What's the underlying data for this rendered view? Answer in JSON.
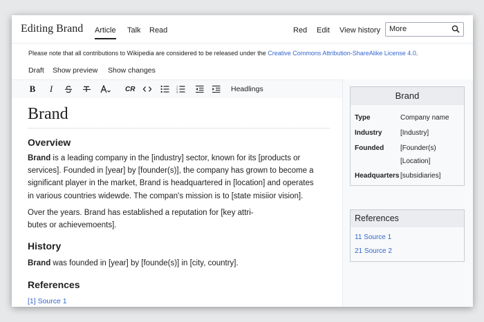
{
  "header": {
    "page_heading": "Editing Brand",
    "tabs": [
      "Article",
      "Talk",
      "Read"
    ],
    "right_tabs": [
      "Red",
      "Edit",
      "View history"
    ],
    "search_placeholder": "More"
  },
  "notice": {
    "text": "Please note that all contributions to Wikipedia are considered to be released under the ",
    "link": "Creative Commons Attribution-ShareAlike License 4.0",
    "end": "."
  },
  "actions": [
    "Draft",
    "Show preview",
    "Show changes"
  ],
  "toolbar": {
    "buttons": [
      "bold",
      "italic",
      "strikethrough",
      "clear-formatting",
      "text-size",
      "cite",
      "code",
      "bulleted-list",
      "numbered-list",
      "outdent",
      "indent"
    ],
    "headings_label": "Headlings"
  },
  "article": {
    "title": "Brand",
    "sections": {
      "overview": {
        "heading": "Overview",
        "p1_bold": "Brand",
        "p1_lines": [
          " is a leading company in the [industry] sector, known for its [products or",
          "services]. Founded in [year] by [founder(s)], the company has grown to become a",
          "significant player in the market, Brand is headquartered in [location] and operates",
          "in various countries widewde. The compan's mission is to [state misiior vision]."
        ],
        "p2_lines": [
          "Over the years. Brand has established a reputation for [key attri-",
          "butes or achievemoents]."
        ]
      },
      "history": {
        "heading": "History",
        "p_bold": "Brand",
        "p_rest": " was founded in [year] by [founde(s)] in [city, country]."
      },
      "references": {
        "heading": "References",
        "items": [
          "[1] Source 1"
        ]
      }
    }
  },
  "infobox": {
    "title": "Brand",
    "rows": [
      {
        "label": "Type",
        "value": "Company name"
      },
      {
        "label": "Industry",
        "value": "[Industry]"
      },
      {
        "label": "Founded",
        "value": "[Founder(s)"
      },
      {
        "label": "",
        "value": "[Location]"
      },
      {
        "label": "Headquarters",
        "value": "[subsidiaries]"
      }
    ]
  },
  "refbox": {
    "title": "References",
    "items": [
      "11 Source 1",
      "21 Source 2"
    ]
  },
  "colors": {
    "link": "#3366cc",
    "text": "#202122",
    "panel": "#f8f9fa",
    "border": "#c8ccd1"
  }
}
